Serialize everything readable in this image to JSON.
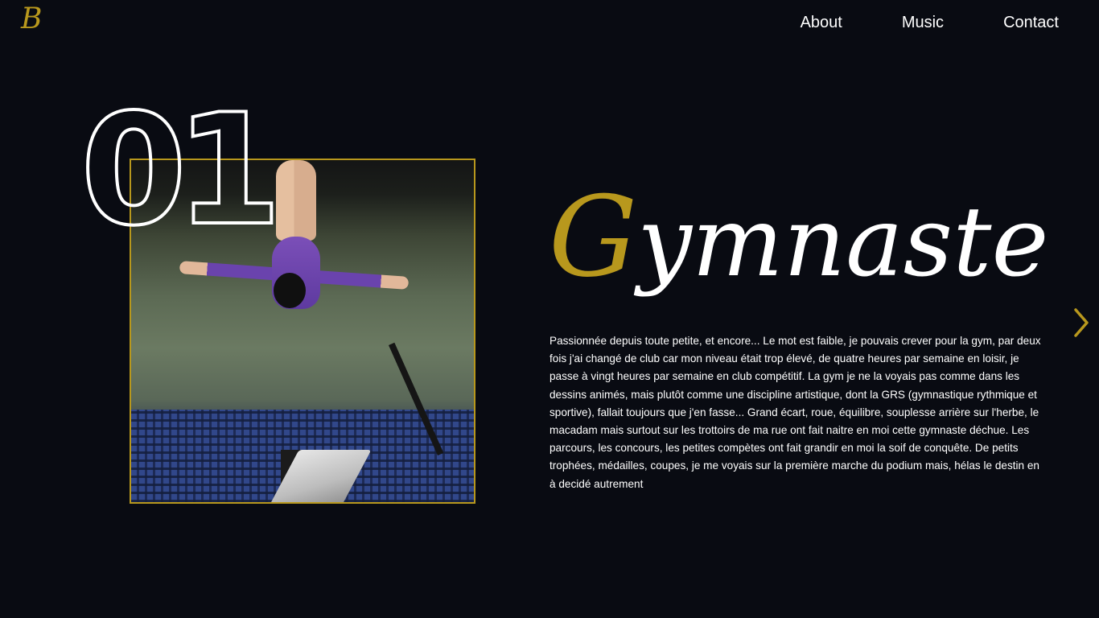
{
  "header": {
    "logo_text": "B",
    "nav": [
      {
        "label": "About"
      },
      {
        "label": "Music"
      },
      {
        "label": "Contact"
      }
    ]
  },
  "section": {
    "number": "01",
    "title_initial": "G",
    "title_rest": "ymnaste",
    "description": "Passionnée depuis toute petite, et encore... Le mot est faible, je pouvais crever pour la gym, par deux fois j'ai changé de club car mon niveau était trop élevé, de quatre heures par semaine en loisir, je passe à vingt heures par semaine en club compétitif. La gym je ne la voyais pas comme dans les dessins animés, mais plutôt comme une discipline artistique, dont la GRS (gymnastique rythmique et sportive), fallait toujours que j'en fasse... Grand écart, roue, équilibre, souplesse arrière sur l'herbe, le macadam mais surtout sur les trottoirs de ma rue ont fait naitre en moi cette gymnaste déchue. Les parcours, les concours, les petites compètes ont fait grandir en moi la soif de conquête. De petits trophées, médailles, coupes, je me voyais sur la première marche du podium mais, hélas le destin en à decidé autrement",
    "next_icon": "chevron-right-icon"
  },
  "colors": {
    "background": "#090b12",
    "accent": "#b8981d",
    "text": "#ffffff"
  }
}
